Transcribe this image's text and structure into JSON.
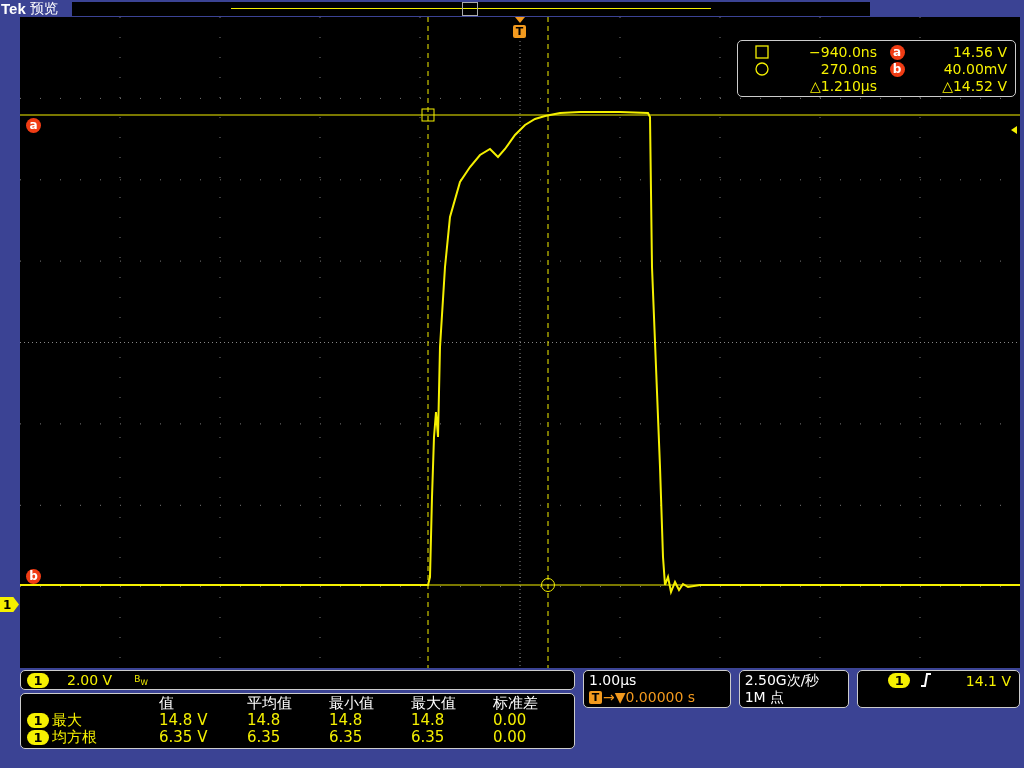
{
  "header": {
    "brand": "Tek",
    "mode": "预览"
  },
  "screen": {
    "trigger_marker": "T",
    "cursor_a_marker": "a",
    "cursor_b_marker": "b",
    "ground_marker": "1"
  },
  "cursor_readout": {
    "rows": [
      {
        "kind": "square",
        "time": "−940.0ns",
        "marker": "a",
        "value": "14.56 V"
      },
      {
        "kind": "circle",
        "time": "270.0ns",
        "marker": "b",
        "value": "40.00mV"
      },
      {
        "kind": "delta",
        "time": "△1.210µs",
        "value": "△14.52 V"
      }
    ]
  },
  "channel": {
    "number": "1",
    "scale": "2.00 V",
    "bandwidth": "B$_{W}$"
  },
  "measurements": {
    "columns": [
      "值",
      "平均值",
      "最小值",
      "最大值",
      "标准差"
    ],
    "rows": [
      {
        "channel": "1",
        "name": "最大",
        "values": [
          "14.8 V",
          "14.8",
          "14.8",
          "14.8",
          "0.00"
        ]
      },
      {
        "channel": "1",
        "name": "均方根",
        "values": [
          "6.35 V",
          "6.35",
          "6.35",
          "6.35",
          "0.00"
        ]
      }
    ]
  },
  "timebase": {
    "scale": "1.00µs",
    "trigger_marker": "T",
    "delay": "→▼0.00000 s"
  },
  "acquisition": {
    "rate": "2.50G次/秒",
    "record": "1M 点"
  },
  "trigger": {
    "channel": "1",
    "rising_edge": true,
    "level": "14.1 V"
  }
}
